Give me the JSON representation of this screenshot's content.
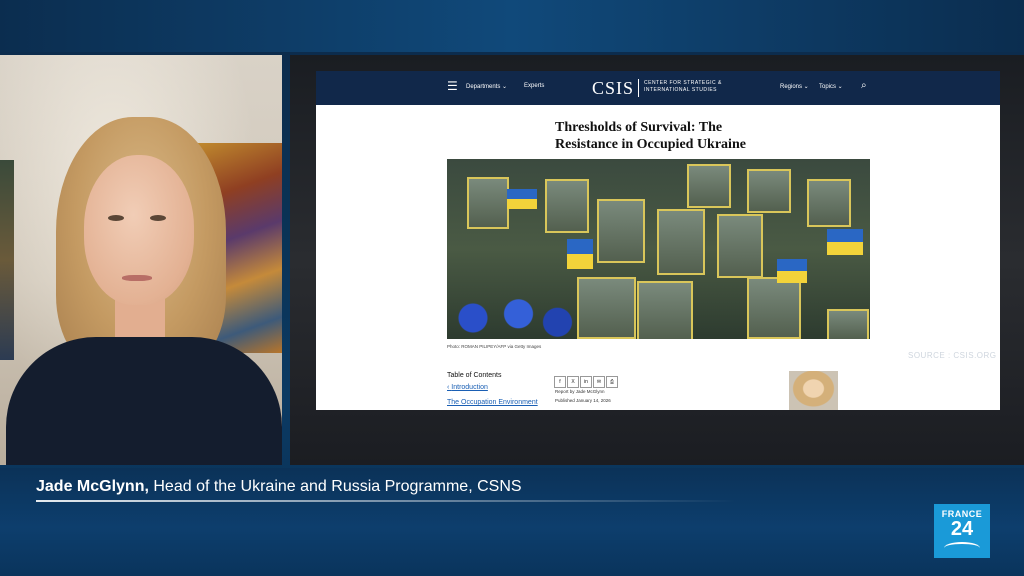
{
  "website": {
    "nav": {
      "departments": "Departments",
      "experts": "Experts",
      "logo": "CSIS",
      "logo_subtitle": "CENTER FOR STRATEGIC & INTERNATIONAL STUDIES",
      "regions": "Regions",
      "topics": "Topics"
    },
    "article": {
      "title": "Thresholds of Survival: The Resistance in Occupied Ukraine",
      "photo_credit": "Photo: ROMAN PILIPEY/AFP via Getty Images",
      "toc_title": "Table of Contents",
      "toc_items": [
        "Introduction",
        "The Occupation Environment"
      ],
      "share_buttons": [
        "f",
        "X",
        "in",
        "✉",
        "⎙"
      ],
      "byline": "Report by Jade McGlynn",
      "published": "Published January 14, 2026"
    },
    "source_tag": "SOURCE : CSIS.ORG"
  },
  "lower_third": {
    "name": "Jade McGlynn,",
    "role": "Head of the Ukraine and Russia Programme, CSNS"
  },
  "channel": {
    "top": "FRANCE",
    "number": "24"
  },
  "colors": {
    "nav_bg": "#11284a",
    "brand_blue": "#1a9ad8",
    "band_blue": "#0b3258"
  }
}
